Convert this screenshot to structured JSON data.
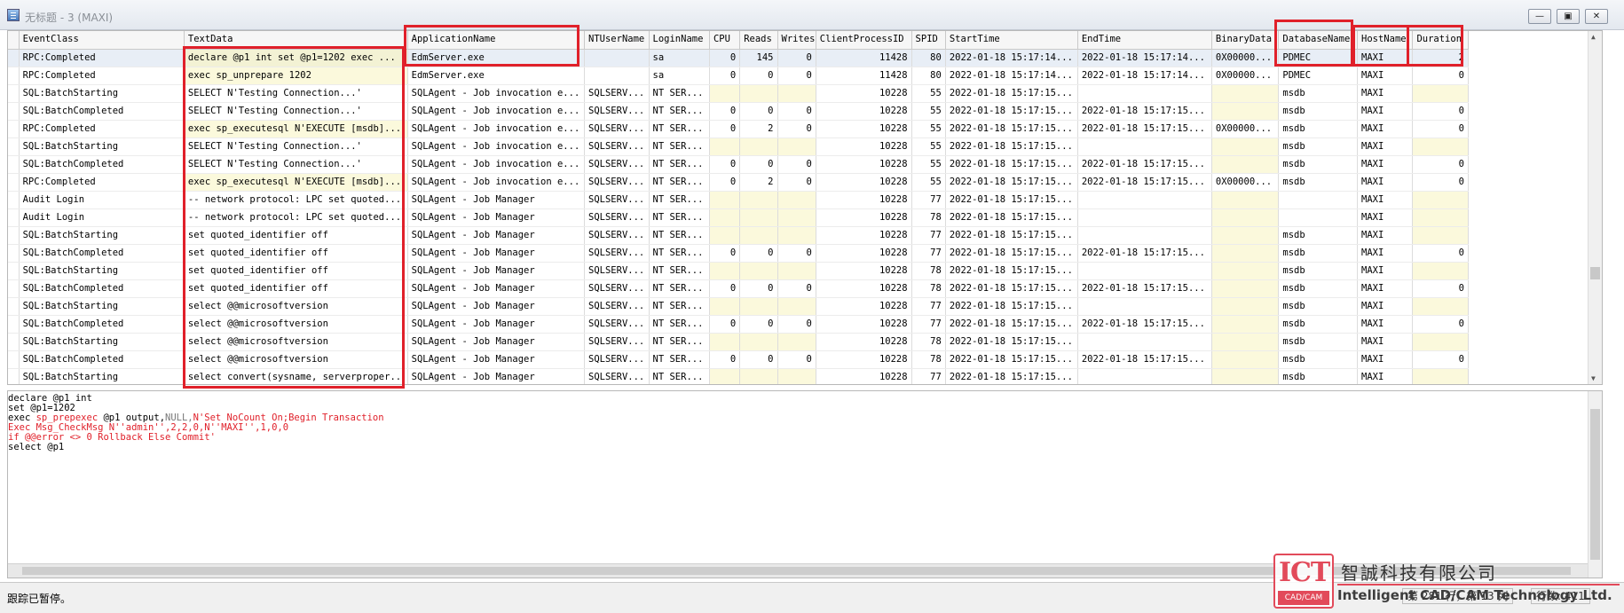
{
  "window": {
    "title": "无标题 - 3 (MAXI)",
    "minimize": "—",
    "maximize": "▣",
    "close": "✕"
  },
  "columns": [
    "",
    "EventClass",
    "TextData",
    "ApplicationName",
    "NTUserName",
    "LoginName",
    "CPU",
    "Reads",
    "Writes",
    "ClientProcessID",
    "SPID",
    "StartTime",
    "EndTime",
    "BinaryData",
    "DatabaseName",
    "HostName",
    "Duration"
  ],
  "rows": [
    [
      "",
      "RPC:Completed",
      "declare @p1 int  set @p1=1202  exec ...",
      "EdmServer.exe",
      "",
      "sa",
      "0",
      "145",
      "0",
      "11428",
      "80",
      "2022-01-18 15:17:14...",
      "2022-01-18 15:17:14...",
      "0X00000...",
      "PDMEC",
      "MAXI",
      "2"
    ],
    [
      "",
      "RPC:Completed",
      "exec sp_unprepare 1202",
      "EdmServer.exe",
      "",
      "sa",
      "0",
      "0",
      "0",
      "11428",
      "80",
      "2022-01-18 15:17:14...",
      "2022-01-18 15:17:14...",
      "0X00000...",
      "PDMEC",
      "MAXI",
      "0"
    ],
    [
      "",
      "SQL:BatchStarting",
      "SELECT N'Testing Connection...'",
      "SQLAgent - Job invocation e...",
      "SQLSERV...",
      "NT SER...",
      "",
      "",
      "",
      "10228",
      "55",
      "2022-01-18 15:17:15...",
      "",
      "",
      "msdb",
      "MAXI",
      ""
    ],
    [
      "",
      "SQL:BatchCompleted",
      "SELECT N'Testing Connection...'",
      "SQLAgent - Job invocation e...",
      "SQLSERV...",
      "NT SER...",
      "0",
      "0",
      "0",
      "10228",
      "55",
      "2022-01-18 15:17:15...",
      "2022-01-18 15:17:15...",
      "",
      "msdb",
      "MAXI",
      "0"
    ],
    [
      "",
      "RPC:Completed",
      "exec sp_executesql N'EXECUTE [msdb]....",
      "SQLAgent - Job invocation e...",
      "SQLSERV...",
      "NT SER...",
      "0",
      "2",
      "0",
      "10228",
      "55",
      "2022-01-18 15:17:15...",
      "2022-01-18 15:17:15...",
      "0X00000...",
      "msdb",
      "MAXI",
      "0"
    ],
    [
      "",
      "SQL:BatchStarting",
      "SELECT N'Testing Connection...'",
      "SQLAgent - Job invocation e...",
      "SQLSERV...",
      "NT SER...",
      "",
      "",
      "",
      "10228",
      "55",
      "2022-01-18 15:17:15...",
      "",
      "",
      "msdb",
      "MAXI",
      ""
    ],
    [
      "",
      "SQL:BatchCompleted",
      "SELECT N'Testing Connection...'",
      "SQLAgent - Job invocation e...",
      "SQLSERV...",
      "NT SER...",
      "0",
      "0",
      "0",
      "10228",
      "55",
      "2022-01-18 15:17:15...",
      "2022-01-18 15:17:15...",
      "",
      "msdb",
      "MAXI",
      "0"
    ],
    [
      "",
      "RPC:Completed",
      "exec sp_executesql N'EXECUTE [msdb]....",
      "SQLAgent - Job invocation e...",
      "SQLSERV...",
      "NT SER...",
      "0",
      "2",
      "0",
      "10228",
      "55",
      "2022-01-18 15:17:15...",
      "2022-01-18 15:17:15...",
      "0X00000...",
      "msdb",
      "MAXI",
      "0"
    ],
    [
      "",
      "Audit Login",
      "-- network protocol: LPC  set quoted...",
      "SQLAgent - Job Manager",
      "SQLSERV...",
      "NT SER...",
      "",
      "",
      "",
      "10228",
      "77",
      "2022-01-18 15:17:15...",
      "",
      "",
      "",
      "MAXI",
      ""
    ],
    [
      "",
      "Audit Login",
      "-- network protocol: LPC  set quoted...",
      "SQLAgent - Job Manager",
      "SQLSERV...",
      "NT SER...",
      "",
      "",
      "",
      "10228",
      "78",
      "2022-01-18 15:17:15...",
      "",
      "",
      "",
      "MAXI",
      ""
    ],
    [
      "",
      "SQL:BatchStarting",
      " set quoted_identifier off",
      "SQLAgent - Job Manager",
      "SQLSERV...",
      "NT SER...",
      "",
      "",
      "",
      "10228",
      "77",
      "2022-01-18 15:17:15...",
      "",
      "",
      "msdb",
      "MAXI",
      ""
    ],
    [
      "",
      "SQL:BatchCompleted",
      " set quoted_identifier off",
      "SQLAgent - Job Manager",
      "SQLSERV...",
      "NT SER...",
      "0",
      "0",
      "0",
      "10228",
      "77",
      "2022-01-18 15:17:15...",
      "2022-01-18 15:17:15...",
      "",
      "msdb",
      "MAXI",
      "0"
    ],
    [
      "",
      "SQL:BatchStarting",
      " set quoted_identifier off",
      "SQLAgent - Job Manager",
      "SQLSERV...",
      "NT SER...",
      "",
      "",
      "",
      "10228",
      "78",
      "2022-01-18 15:17:15...",
      "",
      "",
      "msdb",
      "MAXI",
      ""
    ],
    [
      "",
      "SQL:BatchCompleted",
      " set quoted_identifier off",
      "SQLAgent - Job Manager",
      "SQLSERV...",
      "NT SER...",
      "0",
      "0",
      "0",
      "10228",
      "78",
      "2022-01-18 15:17:15...",
      "2022-01-18 15:17:15...",
      "",
      "msdb",
      "MAXI",
      "0"
    ],
    [
      "",
      "SQL:BatchStarting",
      "select @@microsoftversion",
      "SQLAgent - Job Manager",
      "SQLSERV...",
      "NT SER...",
      "",
      "",
      "",
      "10228",
      "77",
      "2022-01-18 15:17:15...",
      "",
      "",
      "msdb",
      "MAXI",
      ""
    ],
    [
      "",
      "SQL:BatchCompleted",
      "select @@microsoftversion",
      "SQLAgent - Job Manager",
      "SQLSERV...",
      "NT SER...",
      "0",
      "0",
      "0",
      "10228",
      "77",
      "2022-01-18 15:17:15...",
      "2022-01-18 15:17:15...",
      "",
      "msdb",
      "MAXI",
      "0"
    ],
    [
      "",
      "SQL:BatchStarting",
      "select @@microsoftversion",
      "SQLAgent - Job Manager",
      "SQLSERV...",
      "NT SER...",
      "",
      "",
      "",
      "10228",
      "78",
      "2022-01-18 15:17:15...",
      "",
      "",
      "msdb",
      "MAXI",
      ""
    ],
    [
      "",
      "SQL:BatchCompleted",
      "select @@microsoftversion",
      "SQLAgent - Job Manager",
      "SQLSERV...",
      "NT SER...",
      "0",
      "0",
      "0",
      "10228",
      "78",
      "2022-01-18 15:17:15...",
      "2022-01-18 15:17:15...",
      "",
      "msdb",
      "MAXI",
      "0"
    ],
    [
      "",
      "SQL:BatchStarting",
      "select convert(sysname, serverproper...",
      "SQLAgent - Job Manager",
      "SQLSERV...",
      "NT SER...",
      "",
      "",
      "",
      "10228",
      "77",
      "2022-01-18 15:17:15...",
      "",
      "",
      "msdb",
      "MAXI",
      ""
    ]
  ],
  "detail": {
    "line1": "declare @p1 int",
    "line2": "set @p1=1202",
    "line3_a": "exec ",
    "line3_b": "sp_prepexec",
    "line3_c": " @p1 output,",
    "line3_d": "NULL,",
    "line3_e": "N'Set NoCount On;Begin Transaction",
    "line4": "Exec Msg_CheckMsg N''admin'',2,2,0,N''MAXI'',1,0,0",
    "line5": "if @@error <> 0 Rollback Else Commit'",
    "line6": "select @p1"
  },
  "status": {
    "message": "跟踪已暂停。",
    "position": "第 281 行，第 13 列",
    "rows": "行数: 411"
  },
  "watermark": {
    "logo": "ICT",
    "logo_sub": "CAD/CAM",
    "company_cn": "智誠科技有限公司",
    "company_en": "Intelligent CAD/CAM Technology Ltd."
  },
  "colors": {
    "highlight": "#e0202a",
    "yellow_cell": "#fbf9dc",
    "red_text": "#e0202a"
  }
}
